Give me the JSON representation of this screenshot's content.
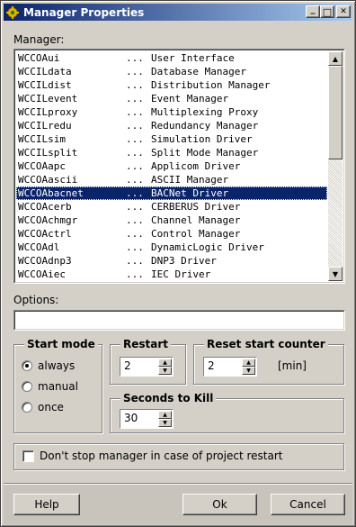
{
  "window": {
    "title": "Manager Properties",
    "accent_color": "#0a246a"
  },
  "manager": {
    "label": "Manager:",
    "selected_index": 10,
    "rows": [
      {
        "name": "WCCOAui",
        "sep": "...",
        "desc": "User Interface"
      },
      {
        "name": "WCCILdata",
        "sep": "...",
        "desc": "Database Manager"
      },
      {
        "name": "WCCILdist",
        "sep": "...",
        "desc": "Distribution Manager"
      },
      {
        "name": "WCCILevent",
        "sep": "...",
        "desc": "Event Manager"
      },
      {
        "name": "WCCILproxy",
        "sep": "...",
        "desc": "Multiplexing Proxy"
      },
      {
        "name": "WCCILredu",
        "sep": "...",
        "desc": "Redundancy Manager"
      },
      {
        "name": "WCCILsim",
        "sep": "...",
        "desc": "Simulation Driver"
      },
      {
        "name": "WCCILsplit",
        "sep": "...",
        "desc": "Split Mode Manager"
      },
      {
        "name": "WCCOAapc",
        "sep": "...",
        "desc": "Applicom Driver"
      },
      {
        "name": "WCCOAascii",
        "sep": "...",
        "desc": "ASCII Manager"
      },
      {
        "name": "WCCOAbacnet",
        "sep": "...",
        "desc": "BACNet Driver"
      },
      {
        "name": "WCCOAcerb",
        "sep": "...",
        "desc": "CERBERUS Driver"
      },
      {
        "name": "WCCOAchmgr",
        "sep": "...",
        "desc": "Channel Manager"
      },
      {
        "name": "WCCOActrl",
        "sep": "...",
        "desc": "Control Manager"
      },
      {
        "name": "WCCOAdl",
        "sep": "...",
        "desc": "DynamicLogic Driver"
      },
      {
        "name": "WCCOAdnp3",
        "sep": "...",
        "desc": "DNP3 Driver"
      },
      {
        "name": "WCCOAiec",
        "sep": "...",
        "desc": "IEC Driver"
      }
    ]
  },
  "options": {
    "label": "Options:",
    "value": ""
  },
  "start_mode": {
    "title": "Start mode",
    "options": [
      "always",
      "manual",
      "once"
    ],
    "selected": "always"
  },
  "restart": {
    "title": "Restart",
    "value": "2"
  },
  "reset_counter": {
    "title": "Reset start counter",
    "value": "2",
    "unit": "[min]"
  },
  "seconds_to_kill": {
    "title": "Seconds to Kill",
    "value": "30"
  },
  "dont_stop": {
    "label": "Don't stop manager in case of project restart",
    "checked": false
  },
  "buttons": {
    "help": "Help",
    "ok": "Ok",
    "cancel": "Cancel"
  },
  "titlebar_buttons": {
    "minimize": "_",
    "maximize": "□",
    "close": "✕"
  }
}
